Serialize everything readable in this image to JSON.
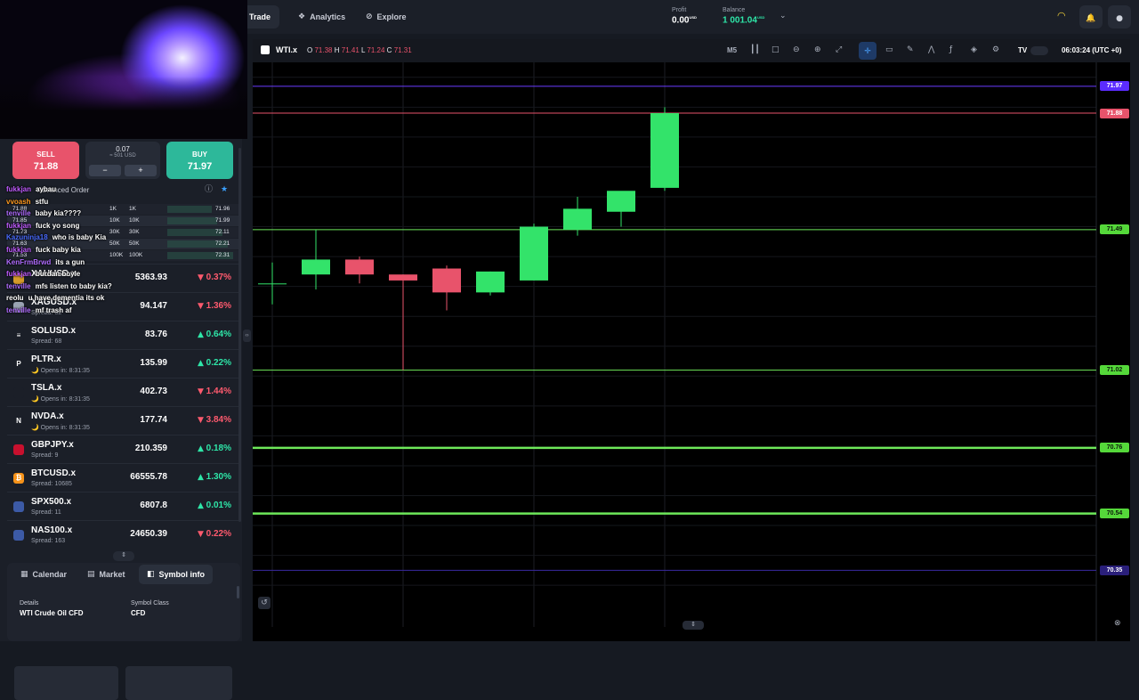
{
  "header": {
    "nav": [
      {
        "label": "Trade",
        "icon": "trade-icon"
      },
      {
        "label": "Analytics",
        "icon": "analytics-icon"
      },
      {
        "label": "Explore",
        "icon": "explore-icon"
      }
    ],
    "profit_label": "Profit",
    "profit_value": "0.00",
    "profit_currency": "USD",
    "balance_label": "Balance",
    "balance_value": "1 001.04",
    "balance_currency": "USD"
  },
  "trade_panel": {
    "sell_label": "SELL",
    "sell_price": "71.88",
    "buy_label": "BUY",
    "buy_price": "71.97",
    "lot": "0.07",
    "lot_usd": "≈ 501 USD",
    "minus": "−",
    "plus": "+",
    "advanced_order": "Advanced Order"
  },
  "ladder": [
    {
      "bid": "71.88",
      "size": "1K",
      "size2": "1K",
      "ask": "71.96"
    },
    {
      "bid": "71.85",
      "size": "10K",
      "size2": "10K",
      "ask": "71.99"
    },
    {
      "bid": "71.73",
      "size": "30K",
      "size2": "30K",
      "ask": "72.11"
    },
    {
      "bid": "71.63",
      "size": "50K",
      "size2": "50K",
      "ask": "72.21"
    },
    {
      "bid": "71.53",
      "size": "100K",
      "size2": "100K",
      "ask": "72.31"
    }
  ],
  "chat": [
    {
      "name": "fukkjan",
      "color": "#c05cff",
      "msg": "aybau"
    },
    {
      "name": "vvoash",
      "color": "#ff9a1f",
      "msg": "stfu"
    },
    {
      "name": "tenville",
      "color": "#b06cff",
      "msg": "baby kia????"
    },
    {
      "name": "fukkjan",
      "color": "#c05cff",
      "msg": "fuck yo song"
    },
    {
      "name": "Kazuninja18",
      "color": "#4a6cff",
      "msg": "who is baby Kia"
    },
    {
      "name": "fukkjan",
      "color": "#c05cff",
      "msg": "fuck baby kia"
    },
    {
      "name": "KenFrmBrwd",
      "color": "#b06cff",
      "msg": "its a gun"
    },
    {
      "name": "fukkjan",
      "color": "#c05cff",
      "msg": "burdan boyle"
    },
    {
      "name": "tenville",
      "color": "#b06cff",
      "msg": "mfs listen to baby kia?"
    },
    {
      "name": "reolu",
      "color": "#ffffff",
      "msg": "u have dementia its ok"
    },
    {
      "name": "tenville",
      "color": "#b06cff",
      "msg": "mf trash af"
    }
  ],
  "watchlist": [
    {
      "symbol": "XAUUSD.x",
      "sub": "",
      "price": "5363.93",
      "change": "0.37%",
      "dir": "down",
      "icon": "gold-icon",
      "iconText": "",
      "iconColor": "#d49a2a"
    },
    {
      "symbol": "XAGUSD.x",
      "sub": "Spread: 82",
      "price": "94.147",
      "change": "1.36%",
      "dir": "down",
      "icon": "silver-icon",
      "iconText": "",
      "iconColor": "#9aa3b3"
    },
    {
      "symbol": "SOLUSD.x",
      "sub": "Spread: 68",
      "price": "83.76",
      "change": "0.64%",
      "dir": "up",
      "icon": "solana-icon",
      "iconText": "≡",
      "iconColor": "#1b1f28"
    },
    {
      "symbol": "PLTR.x",
      "sub": "🌙 Opens in: 8:31:35",
      "price": "135.99",
      "change": "0.22%",
      "dir": "up",
      "icon": "palantir-icon",
      "iconText": "P",
      "iconColor": "#1b1f28"
    },
    {
      "symbol": "TSLA.x",
      "sub": "🌙 Opens in: 8:31:35",
      "price": "402.73",
      "change": "1.44%",
      "dir": "down",
      "icon": "tesla-icon",
      "iconText": "",
      "iconColor": "#1b1f28"
    },
    {
      "symbol": "NVDA.x",
      "sub": "🌙 Opens in: 8:31:35",
      "price": "177.74",
      "change": "3.84%",
      "dir": "down",
      "icon": "nvidia-icon",
      "iconText": "N",
      "iconColor": "#1b1f28"
    },
    {
      "symbol": "GBPJPY.x",
      "sub": "Spread: 9",
      "price": "210.359",
      "change": "0.18%",
      "dir": "up",
      "icon": "gbp-flag-icon",
      "iconText": "",
      "iconColor": "#c8102e"
    },
    {
      "symbol": "BTCUSD.x",
      "sub": "Spread: 10685",
      "price": "66555.78",
      "change": "1.30%",
      "dir": "up",
      "icon": "bitcoin-icon",
      "iconText": "₿",
      "iconColor": "#f7931a"
    },
    {
      "symbol": "SPX500.x",
      "sub": "Spread: 11",
      "price": "6807.8",
      "change": "0.01%",
      "dir": "up",
      "icon": "us-flag-icon",
      "iconText": "",
      "iconColor": "#3c5aa6"
    },
    {
      "symbol": "NAS100.x",
      "sub": "Spread: 163",
      "price": "24650.39",
      "change": "0.22%",
      "dir": "down",
      "icon": "us-flag-icon",
      "iconText": "",
      "iconColor": "#3c5aa6"
    }
  ],
  "bottom_tabs": [
    {
      "label": "Calendar",
      "icon": "calendar-icon",
      "active": false
    },
    {
      "label": "Market",
      "icon": "market-icon",
      "active": false
    },
    {
      "label": "Symbol info",
      "icon": "info-icon",
      "active": true
    }
  ],
  "symbol_info": {
    "details_label": "Details",
    "details_value": "WTI Crude Oil CFD",
    "class_label": "Symbol Class",
    "class_value": "CFD"
  },
  "chart_toolbar": {
    "symbol": "WTI.x",
    "o_label": "O",
    "o": "71.38",
    "h_label": "H",
    "h": "71.41",
    "l_label": "L",
    "l": "71.24",
    "c_label": "C",
    "c": "71.31",
    "timeframe": "M5",
    "clock": "06:03:24 (UTC +0)"
  },
  "chart_data": {
    "type": "candlestick",
    "symbol": "WTI.x",
    "timeframe": "M5",
    "ylim": [
      70.22,
      72.05
    ],
    "candles": [
      {
        "o": 71.31,
        "h": 71.38,
        "l": 71.24,
        "c": 71.31
      },
      {
        "o": 71.34,
        "h": 71.49,
        "l": 71.29,
        "c": 71.39
      },
      {
        "o": 71.39,
        "h": 71.4,
        "l": 71.31,
        "c": 71.34
      },
      {
        "o": 71.34,
        "h": 71.34,
        "l": 71.02,
        "c": 71.32
      },
      {
        "o": 71.36,
        "h": 71.37,
        "l": 71.22,
        "c": 71.28
      },
      {
        "o": 71.28,
        "h": 71.35,
        "l": 71.27,
        "c": 71.35
      },
      {
        "o": 71.32,
        "h": 71.51,
        "l": 71.32,
        "c": 71.5
      },
      {
        "o": 71.49,
        "h": 71.6,
        "l": 71.47,
        "c": 71.56
      },
      {
        "o": 71.55,
        "h": 71.61,
        "l": 71.5,
        "c": 71.62
      },
      {
        "o": 71.63,
        "h": 71.9,
        "l": 71.62,
        "c": 71.88
      }
    ],
    "price_lines": [
      {
        "price": "71.97",
        "kind": "ask"
      },
      {
        "price": "71.88",
        "kind": "bid"
      },
      {
        "price": "71.49",
        "kind": "level"
      },
      {
        "price": "71.02",
        "kind": "level"
      },
      {
        "price": "70.76",
        "kind": "level"
      },
      {
        "price": "70.54",
        "kind": "level"
      },
      {
        "price": "70.35",
        "kind": "level-purple"
      }
    ],
    "colors": {
      "up": "#33e36a",
      "down": "#e8536b",
      "level": "#6ee85a",
      "ask": "#6a3cff",
      "bid": "#e8536b"
    }
  }
}
